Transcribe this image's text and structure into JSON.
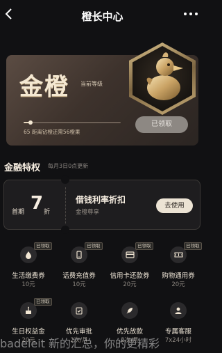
{
  "nav": {
    "title": "橙长中心"
  },
  "member": {
    "level_name": "金橙",
    "level_tag": "当前等级",
    "progress": 0.07,
    "progress_text": "65 距离钻橙还需56橙果",
    "claimed_label": "已领取"
  },
  "section": {
    "title": "金融特权",
    "subtitle": "每月3日0点更新"
  },
  "coupon": {
    "prefix": "首期",
    "number": "7",
    "unit": "折",
    "name": "借钱利率折扣",
    "desc": "金橙尊享",
    "button": "去使用"
  },
  "privileges": [
    {
      "name": "生活缴费券",
      "value": "10元",
      "tag": "已领取",
      "icon": "water-drop-icon"
    },
    {
      "name": "话费充值券",
      "value": "10元",
      "tag": "已领取",
      "icon": "phone-icon"
    },
    {
      "name": "信用卡还款券",
      "value": "20元",
      "tag": "已领取",
      "icon": "credit-card-icon"
    },
    {
      "name": "购物通用券",
      "value": "20元",
      "tag": "已领取",
      "icon": "ticket-icon"
    },
    {
      "name": "生日权益金",
      "value": "20元",
      "tag": "已领取",
      "icon": "cake-icon"
    },
    {
      "name": "优先审批",
      "value": "2次/月",
      "tag": "",
      "icon": "clipboard-check-icon"
    },
    {
      "name": "优先放款",
      "value": "2次/月",
      "tag": "",
      "icon": "rocket-icon"
    },
    {
      "name": "专属客服",
      "value": "7x24小时",
      "tag": "",
      "icon": "service-agent-icon"
    }
  ],
  "watermark": "badeleit 新的汇总，你的更精彩"
}
